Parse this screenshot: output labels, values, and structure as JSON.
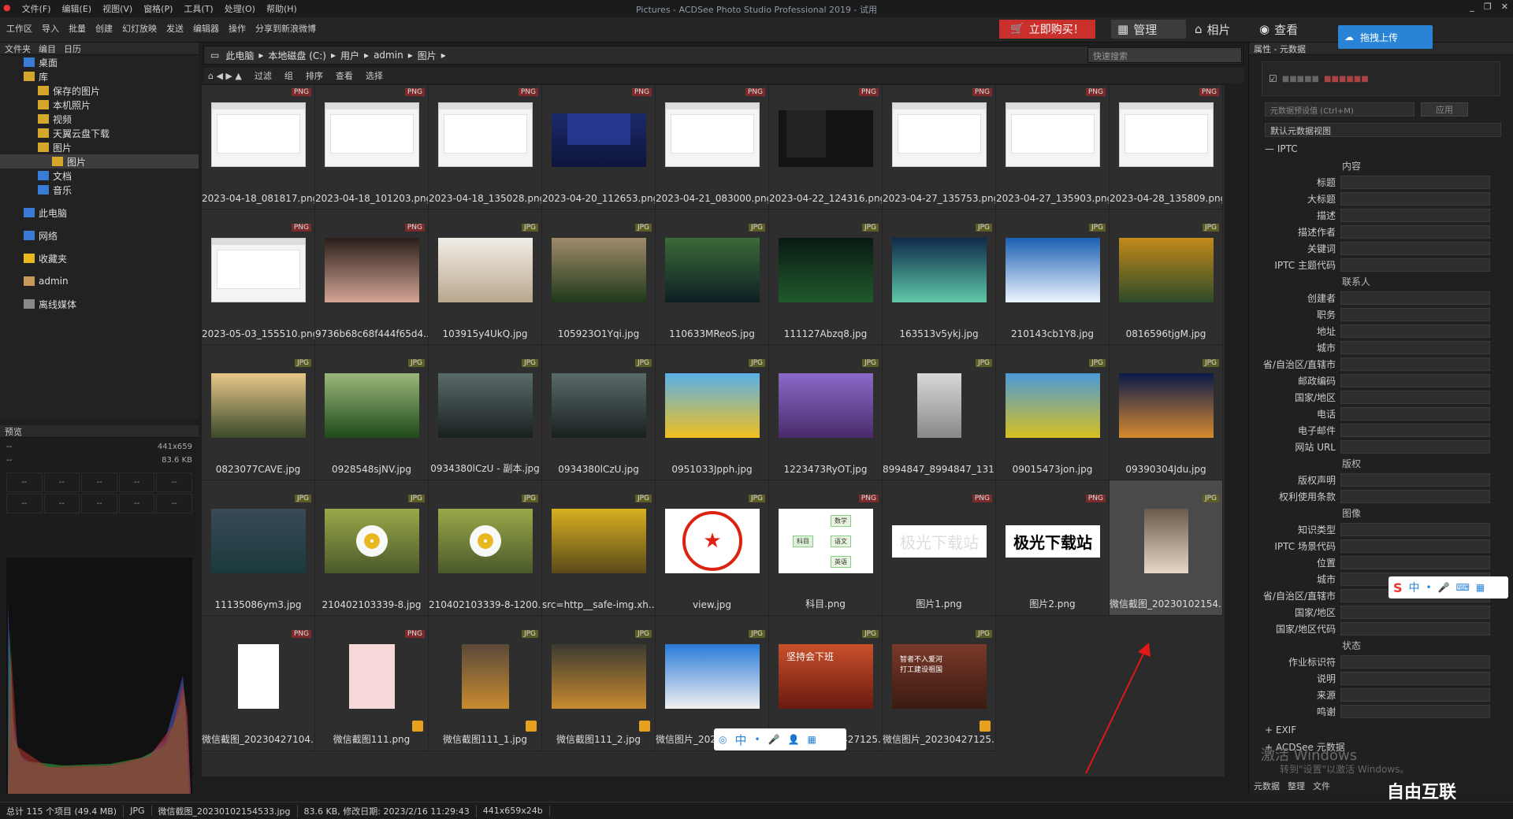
{
  "titlebar": {
    "menu": [
      "文件(F)",
      "编辑(E)",
      "视图(V)",
      "窗格(P)",
      "工具(T)",
      "处理(O)",
      "帮助(H)"
    ],
    "title": "Pictures - ACDSee Photo Studio Professional 2019 - 试用"
  },
  "toolbar": {
    "tools": [
      "工作区",
      "导入",
      "批量",
      "创建",
      "幻灯放映",
      "发送",
      "编辑器",
      "操作",
      "分享到新浪微博"
    ],
    "buy": "立即购买！",
    "manage": "管理",
    "album": "相片",
    "view": "查看",
    "upload": "拖拽上传"
  },
  "folders": {
    "tabs": [
      "文件夹",
      "编目",
      "日历"
    ],
    "items": [
      {
        "label": "桌面",
        "level": 0
      },
      {
        "label": "库",
        "level": 0
      },
      {
        "label": "保存的图片",
        "level": 1
      },
      {
        "label": "本机照片",
        "level": 1
      },
      {
        "label": "视频",
        "level": 1
      },
      {
        "label": "天翼云盘下载",
        "level": 1
      },
      {
        "label": "图片",
        "level": 1
      },
      {
        "label": "图片",
        "level": 2
      },
      {
        "label": "文档",
        "level": 1
      },
      {
        "label": "音乐",
        "level": 1
      },
      {
        "label": "此电脑",
        "level": 0
      },
      {
        "label": "网络",
        "level": 0
      },
      {
        "label": "收藏夹",
        "level": 0
      },
      {
        "label": "admin",
        "level": 0
      },
      {
        "label": "离线媒体",
        "level": 0
      }
    ]
  },
  "preview": {
    "title": "预览",
    "dims": "441x659",
    "size": "83.6 KB",
    "dash": "--"
  },
  "address": {
    "crumbs": [
      "此电脑",
      "本地磁盘 (C:)",
      "用户",
      "admin",
      "图片"
    ],
    "search_placeholder": "快速搜索"
  },
  "filterbar": [
    "过滤",
    "组",
    "排序",
    "查看",
    "选择"
  ],
  "files": [
    {
      "name": "2023-04-18_081817.png",
      "type": "PNG",
      "thumb": "screen-light"
    },
    {
      "name": "2023-04-18_101203.png",
      "type": "PNG",
      "thumb": "screen-light"
    },
    {
      "name": "2023-04-18_135028.png",
      "type": "PNG",
      "thumb": "screen-light"
    },
    {
      "name": "2023-04-20_112653.png",
      "type": "PNG",
      "thumb": "screen-dark-blue"
    },
    {
      "name": "2023-04-21_083000.png",
      "type": "PNG",
      "thumb": "screen-light"
    },
    {
      "name": "2023-04-22_124316.png",
      "type": "PNG",
      "thumb": "screen-dark"
    },
    {
      "name": "2023-04-27_135753.png",
      "type": "PNG",
      "thumb": "screen-light"
    },
    {
      "name": "2023-04-27_135903.png",
      "type": "PNG",
      "thumb": "screen-light"
    },
    {
      "name": "2023-04-28_135809.png",
      "type": "PNG",
      "thumb": "screen-light"
    },
    {
      "name": "2023-05-03_155510.png",
      "type": "PNG",
      "thumb": "screen-light"
    },
    {
      "name": "9736b68c68f444f65d4...",
      "type": "PNG",
      "thumb": "portrait"
    },
    {
      "name": "103915y4UkQ.jpg",
      "type": "JPG",
      "thumb": "dune"
    },
    {
      "name": "105923O1Yqi.jpg",
      "type": "JPG",
      "thumb": "forest"
    },
    {
      "name": "110633MReoS.jpg",
      "type": "JPG",
      "thumb": "lake"
    },
    {
      "name": "111127Abzq8.jpg",
      "type": "JPG",
      "thumb": "aurora"
    },
    {
      "name": "163513v5ykj.jpg",
      "type": "JPG",
      "thumb": "aurora2"
    },
    {
      "name": "210143cb1Y8.jpg",
      "type": "JPG",
      "thumb": "clouds"
    },
    {
      "name": "0816596tjgM.jpg",
      "type": "JPG",
      "thumb": "autumn"
    },
    {
      "name": "0823077CAVE.jpg",
      "type": "JPG",
      "thumb": "mountain"
    },
    {
      "name": "0928548sjNV.jpg",
      "type": "JPG",
      "thumb": "green"
    },
    {
      "name": "0934380lCzU - 副本.jpg",
      "type": "JPG",
      "thumb": "river"
    },
    {
      "name": "0934380lCzU.jpg",
      "type": "JPG",
      "thumb": "river"
    },
    {
      "name": "0951033Jpph.jpg",
      "type": "JPG",
      "thumb": "yellow"
    },
    {
      "name": "1223473RyOT.jpg",
      "type": "JPG",
      "thumb": "flowers"
    },
    {
      "name": "8994847_8994847_131...",
      "type": "JPG",
      "thumb": "person"
    },
    {
      "name": "09015473jon.jpg",
      "type": "JPG",
      "thumb": "field"
    },
    {
      "name": "09390304Jdu.jpg",
      "type": "JPG",
      "thumb": "citynight"
    },
    {
      "name": "11135086ym3.jpg",
      "type": "JPG",
      "thumb": "sea"
    },
    {
      "name": "210402103339-8.jpg",
      "type": "JPG",
      "thumb": "daisy"
    },
    {
      "name": "210402103339-8-1200...",
      "type": "JPG",
      "thumb": "daisy"
    },
    {
      "name": "src=http__safe-img.xh...",
      "type": "JPG",
      "thumb": "yellowleaves"
    },
    {
      "name": "view.jpg",
      "type": "JPG",
      "thumb": "stamp"
    },
    {
      "name": "科目.png",
      "type": "PNG",
      "thumb": "mindmap"
    },
    {
      "name": "图片1.png",
      "type": "PNG",
      "thumb": "textlight"
    },
    {
      "name": "图片2.png",
      "type": "PNG",
      "thumb": "textbold"
    },
    {
      "name": "微信截图_20230102154...",
      "type": "JPG",
      "thumb": "woman",
      "selected": true
    },
    {
      "name": "微信截图_20230427104...",
      "type": "PNG",
      "thumb": "sketch"
    },
    {
      "name": "微信截图111.png",
      "type": "PNG",
      "thumb": "cartoon",
      "check": true
    },
    {
      "name": "微信截图111_1.jpg",
      "type": "JPG",
      "thumb": "leaf",
      "check": true
    },
    {
      "name": "微信截图111_2.jpg",
      "type": "JPG",
      "thumb": "leaf2",
      "check": true
    },
    {
      "name": "微信图片_20230317105...",
      "type": "JPG",
      "thumb": "husky"
    },
    {
      "name": "微信图片_20230427125...",
      "type": "JPG",
      "thumb": "poster1"
    },
    {
      "name": "微信图片_20230427125...",
      "type": "JPG",
      "thumb": "poster2",
      "check": true
    }
  ],
  "thumbtext": {
    "textlight": "极光下载站",
    "textbold": "极光下载站",
    "mind_root": "科目",
    "mind_items": [
      "数学",
      "语文",
      "英语"
    ],
    "poster1": "坚持会下班",
    "poster2": "智者不入爱河\n打工建设祖国"
  },
  "right": {
    "header": "属性 - 元数据",
    "preset": "元数据预设值 (Ctrl+M)",
    "apply": "应用",
    "view": "默认元数据视图",
    "iptc": "IPTC",
    "rows": [
      {
        "label": "内容",
        "section": true
      },
      {
        "label": "标题"
      },
      {
        "label": "大标题"
      },
      {
        "label": "描述"
      },
      {
        "label": "描述作者"
      },
      {
        "label": "关键词"
      },
      {
        "label": "IPTC 主题代码"
      },
      {
        "label": "联系人",
        "section": true
      },
      {
        "label": "创建者"
      },
      {
        "label": "职务"
      },
      {
        "label": "地址"
      },
      {
        "label": "城市"
      },
      {
        "label": "省/自治区/直辖市"
      },
      {
        "label": "邮政编码"
      },
      {
        "label": "国家/地区"
      },
      {
        "label": "电话"
      },
      {
        "label": "电子邮件"
      },
      {
        "label": "网站 URL"
      },
      {
        "label": "版权",
        "section": true
      },
      {
        "label": "版权声明"
      },
      {
        "label": "权利使用条款"
      },
      {
        "label": "图像",
        "section": true
      },
      {
        "label": "知识类型"
      },
      {
        "label": "IPTC 场景代码"
      },
      {
        "label": "位置"
      },
      {
        "label": "城市"
      },
      {
        "label": "省/自治区/直辖市"
      },
      {
        "label": "国家/地区"
      },
      {
        "label": "国家/地区代码"
      },
      {
        "label": "状态",
        "section": true
      },
      {
        "label": "作业标识符"
      },
      {
        "label": "说明"
      },
      {
        "label": "来源"
      },
      {
        "label": "鸣谢"
      }
    ],
    "exif": "EXIF",
    "acdsee": "ACDSee 元数据",
    "tabs": [
      "元数据",
      "整理",
      "文件"
    ]
  },
  "status": {
    "total": "总计 115 个项目 (49.4 MB)",
    "type": "JPG",
    "file": "微信截图_20230102154533.jpg",
    "info": "83.6 KB, 修改日期: 2023/2/16 11:29:43",
    "dims": "441x659x24b"
  },
  "watermark": {
    "line1": "激活 Windows",
    "line2": "转到\"设置\"以激活 Windows。"
  },
  "logo": "自由互联",
  "ime": [
    "中",
    "·",
    "?",
    "?"
  ],
  "colors": {
    "buy": "#c9302c",
    "upload": "#2a84d6",
    "select": "#4a4a4a"
  }
}
